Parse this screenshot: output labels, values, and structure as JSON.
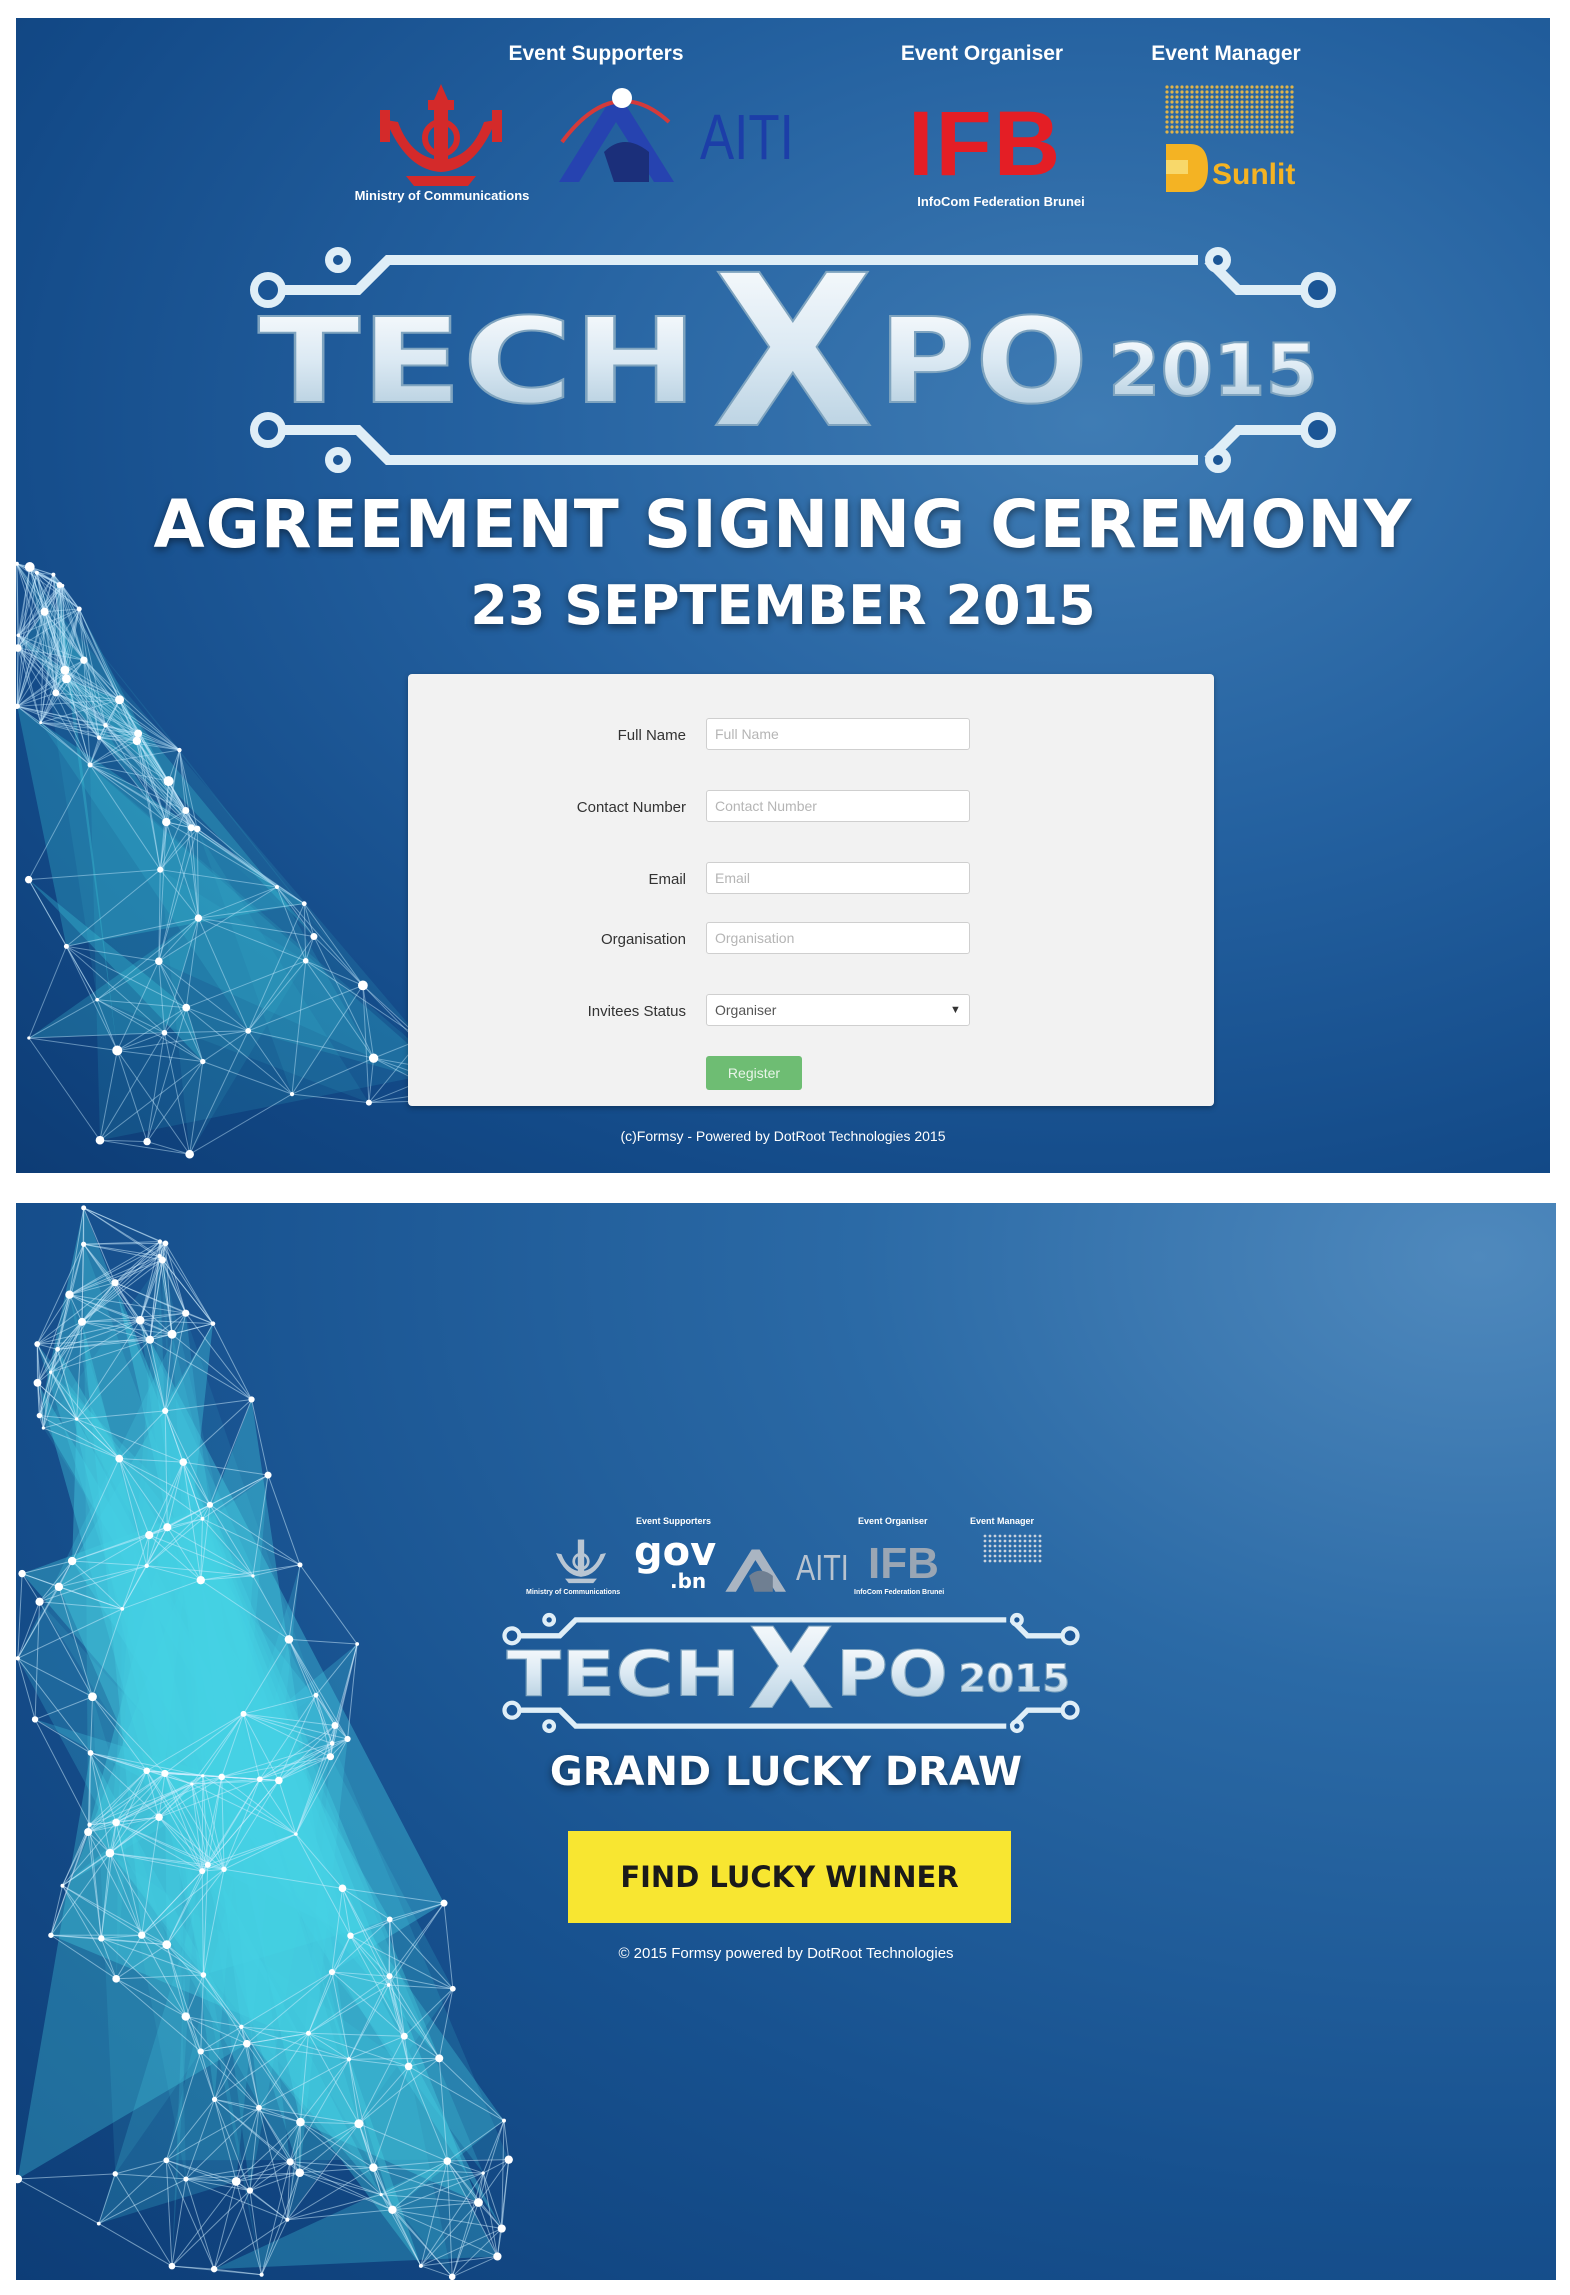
{
  "top": {
    "supporters": {
      "supporters_label": "Event Supporters",
      "organiser_label": "Event Organiser",
      "manager_label": "Event Manager",
      "moc_caption": "Ministry of Communications",
      "aiti_text": "AITI",
      "ifb_text": "IFB",
      "ifb_caption": "InfoCom Federation Brunei",
      "sunlit_text": "Sunlit"
    },
    "logo": {
      "tech": "TECH",
      "x": "X",
      "po": "PO",
      "year": "2015"
    },
    "title": "AGREEMENT SIGNING CEREMONY",
    "date": "23 SEPTEMBER 2015",
    "form": {
      "full_name_label": "Full Name",
      "full_name_placeholder": "Full Name",
      "contact_label": "Contact Number",
      "contact_placeholder": "Contact Number",
      "email_label": "Email",
      "email_placeholder": "Email",
      "organisation_label": "Organisation",
      "organisation_placeholder": "Organisation",
      "status_label": "Invitees Status",
      "status_value": "Organiser",
      "register_label": "Register"
    },
    "footer": "(c)Formsy - Powered by DotRoot Technologies 2015"
  },
  "bottom": {
    "supporters": {
      "supporters_label": "Event Supporters",
      "organiser_label": "Event Organiser",
      "manager_label": "Event Manager",
      "moc_caption": "Ministry of Communications",
      "gov_text": "gov",
      "bn_text": ".bn",
      "aiti_text": "AITI",
      "ifb_text": "IFB",
      "ifb_caption": "InfoCom Federation Brunei"
    },
    "logo": {
      "tech": "TECH",
      "x": "X",
      "po": "PO",
      "year": "2015"
    },
    "title": "GRAND LUCKY DRAW",
    "button_label": "FIND LUCKY WINNER",
    "footer": "© 2015 Formsy powered by DotRoot Technologies"
  },
  "colors": {
    "background_blue": "#1b5696",
    "ifb_red": "#e41e25",
    "button_yellow": "#f8e631",
    "register_green": "#6ebd73"
  }
}
